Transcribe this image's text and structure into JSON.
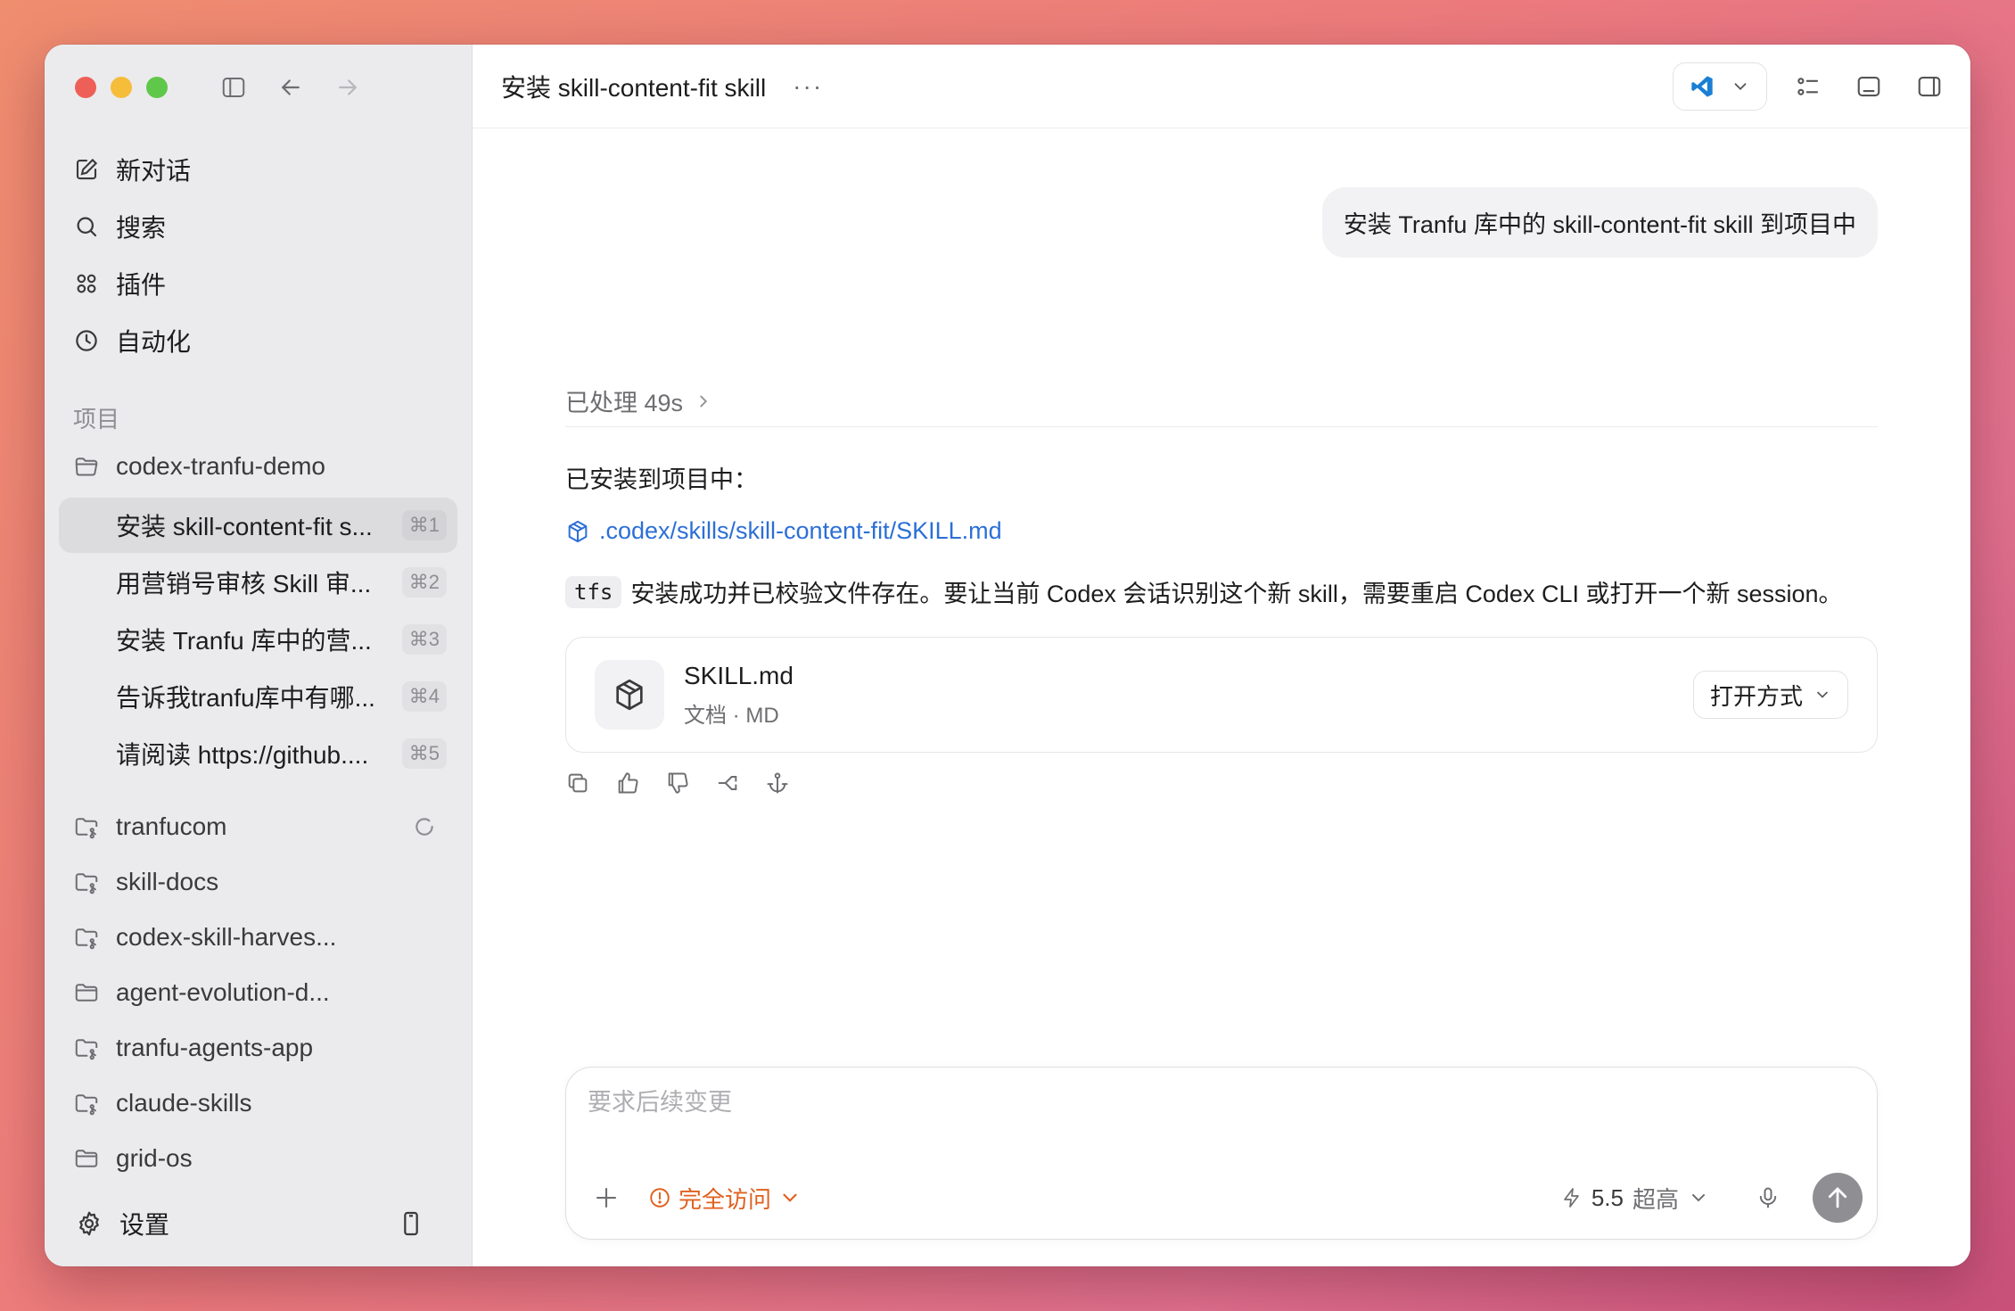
{
  "sidebar": {
    "nav": [
      {
        "label": "新对话",
        "icon": "compose-icon"
      },
      {
        "label": "搜索",
        "icon": "search-icon"
      },
      {
        "label": "插件",
        "icon": "plugins-icon"
      },
      {
        "label": "自动化",
        "icon": "clock-icon"
      }
    ],
    "section_label": "项目",
    "project_open": "codex-tranfu-demo",
    "threads": [
      {
        "label": "安装 skill-content-fit s...",
        "shortcut": "⌘1",
        "active": true
      },
      {
        "label": "用营销号审核 Skill 审...",
        "shortcut": "⌘2"
      },
      {
        "label": "安装 Tranfu 库中的营...",
        "shortcut": "⌘3"
      },
      {
        "label": "告诉我tranfu库中有哪...",
        "shortcut": "⌘4"
      },
      {
        "label": "请阅读 https://github....",
        "shortcut": "⌘5"
      }
    ],
    "projects": [
      {
        "label": "tranfucom",
        "icon": "git-folder-icon",
        "loading": true
      },
      {
        "label": "skill-docs",
        "icon": "git-folder-icon"
      },
      {
        "label": "codex-skill-harves...",
        "icon": "git-folder-icon"
      },
      {
        "label": "agent-evolution-d...",
        "icon": "folder-icon"
      },
      {
        "label": "tranfu-agents-app",
        "icon": "git-folder-icon"
      },
      {
        "label": "claude-skills",
        "icon": "git-folder-icon"
      },
      {
        "label": "grid-os",
        "icon": "folder-icon"
      }
    ],
    "settings_label": "设置"
  },
  "header": {
    "title": "安装 skill-content-fit skill",
    "more": "···"
  },
  "conversation": {
    "user_message": "安装 Tranfu 库中的 skill-content-fit skill 到项目中",
    "processed": "已处理 49s",
    "reply_intro": "已安装到项目中：",
    "reply_path": ".codex/skills/skill-content-fit/SKILL.md",
    "reply_code": "tfs",
    "reply_text": "安装成功并已校验文件存在。要让当前 Codex 会话识别这个新 skill，需要重启 Codex CLI 或打开一个新 session。",
    "file": {
      "name": "SKILL.md",
      "type": "文档 · MD",
      "open_with": "打开方式"
    }
  },
  "composer": {
    "placeholder": "要求后续变更",
    "access_label": "完全访问",
    "model_version": "5.5",
    "model_effort": "超高"
  },
  "colors": {
    "accent_link": "#2c6fd6",
    "access_warning": "#e0601e",
    "sidebar_bg": "#ebebed"
  }
}
